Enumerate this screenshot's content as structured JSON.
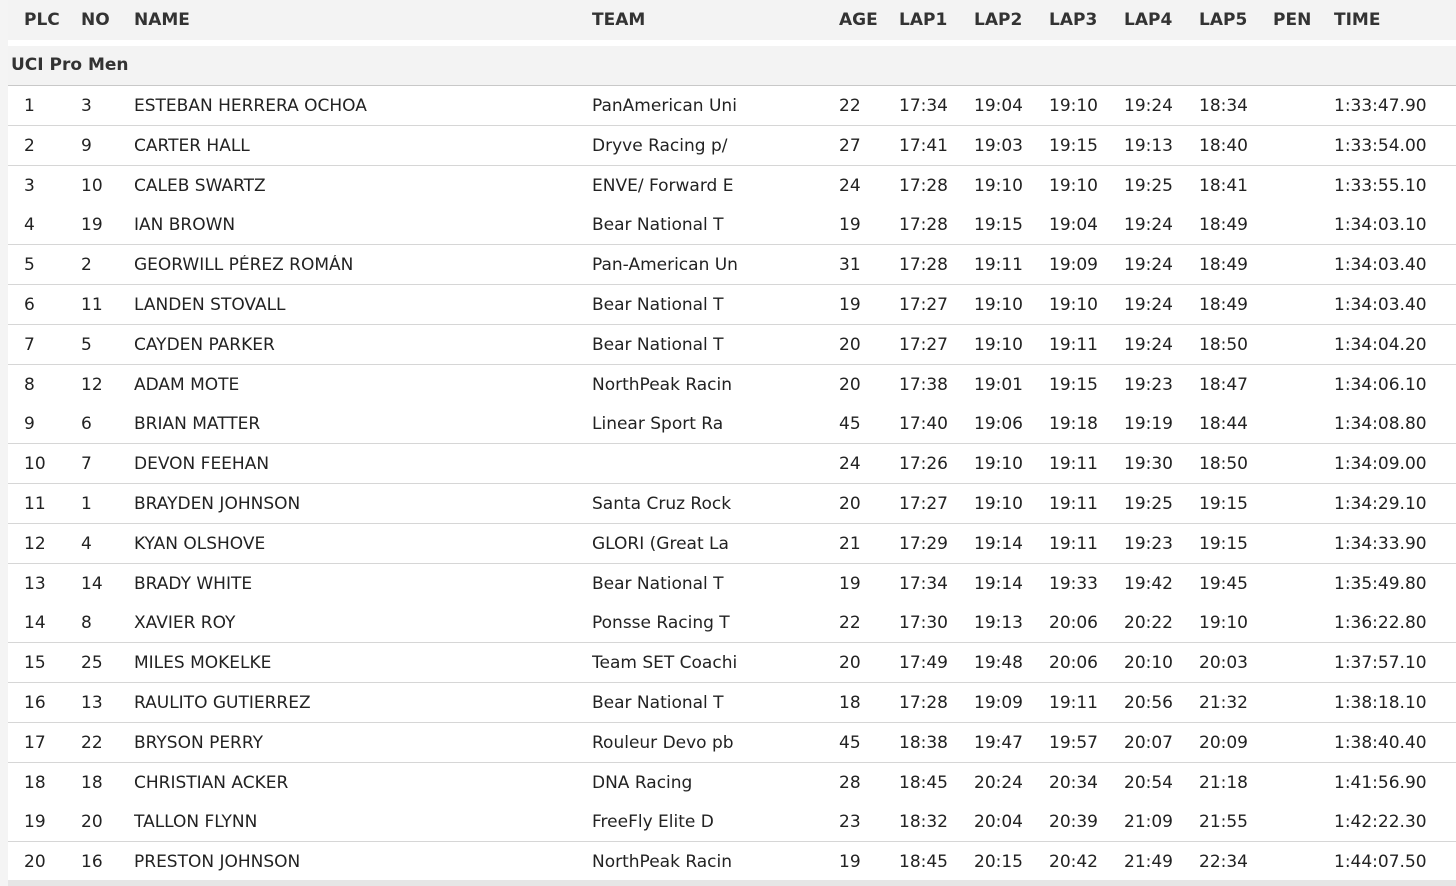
{
  "table": {
    "headers": {
      "plc": "PLC",
      "no": "NO",
      "name": "NAME",
      "team": "TEAM",
      "age": "AGE",
      "lap1": "LAP1",
      "lap2": "LAP2",
      "lap3": "LAP3",
      "lap4": "LAP4",
      "lap5": "LAP5",
      "pen": "PEN",
      "time": "TIME"
    },
    "group": "UCI Pro Men",
    "rows": [
      {
        "plc": "1",
        "no": "3",
        "name": "ESTEBAN HERRERA OCHOA",
        "team": "PanAmerican Uni",
        "age": "22",
        "lap1": "17:34",
        "lap2": "19:04",
        "lap3": "19:10",
        "lap4": "19:24",
        "lap5": "18:34",
        "pen": "",
        "time": "1:33:47.90"
      },
      {
        "plc": "2",
        "no": "9",
        "name": "CARTER HALL",
        "team": "Dryve Racing p/",
        "age": "27",
        "lap1": "17:41",
        "lap2": "19:03",
        "lap3": "19:15",
        "lap4": "19:13",
        "lap5": "18:40",
        "pen": "",
        "time": "1:33:54.00"
      },
      {
        "plc": "3",
        "no": "10",
        "name": "CALEB SWARTZ",
        "team": "ENVE/ Forward E",
        "age": "24",
        "lap1": "17:28",
        "lap2": "19:10",
        "lap3": "19:10",
        "lap4": "19:25",
        "lap5": "18:41",
        "pen": "",
        "time": "1:33:55.10"
      },
      {
        "plc": "4",
        "no": "19",
        "name": "IAN BROWN",
        "team": "Bear National T",
        "age": "19",
        "lap1": "17:28",
        "lap2": "19:15",
        "lap3": "19:04",
        "lap4": "19:24",
        "lap5": "18:49",
        "pen": "",
        "time": "1:34:03.10"
      },
      {
        "plc": "5",
        "no": "2",
        "name": "GEORWILL PÉREZ ROMÁN",
        "team": "Pan-American Un",
        "age": "31",
        "lap1": "17:28",
        "lap2": "19:11",
        "lap3": "19:09",
        "lap4": "19:24",
        "lap5": "18:49",
        "pen": "",
        "time": "1:34:03.40"
      },
      {
        "plc": "6",
        "no": "11",
        "name": "LANDEN STOVALL",
        "team": "Bear National T",
        "age": "19",
        "lap1": "17:27",
        "lap2": "19:10",
        "lap3": "19:10",
        "lap4": "19:24",
        "lap5": "18:49",
        "pen": "",
        "time": "1:34:03.40"
      },
      {
        "plc": "7",
        "no": "5",
        "name": "CAYDEN PARKER",
        "team": "Bear National T",
        "age": "20",
        "lap1": "17:27",
        "lap2": "19:10",
        "lap3": "19:11",
        "lap4": "19:24",
        "lap5": "18:50",
        "pen": "",
        "time": "1:34:04.20"
      },
      {
        "plc": "8",
        "no": "12",
        "name": "ADAM MOTE",
        "team": "NorthPeak Racin",
        "age": "20",
        "lap1": "17:38",
        "lap2": "19:01",
        "lap3": "19:15",
        "lap4": "19:23",
        "lap5": "18:47",
        "pen": "",
        "time": "1:34:06.10"
      },
      {
        "plc": "9",
        "no": "6",
        "name": "BRIAN MATTER",
        "team": "Linear Sport Ra",
        "age": "45",
        "lap1": "17:40",
        "lap2": "19:06",
        "lap3": "19:18",
        "lap4": "19:19",
        "lap5": "18:44",
        "pen": "",
        "time": "1:34:08.80"
      },
      {
        "plc": "10",
        "no": "7",
        "name": "DEVON FEEHAN",
        "team": "",
        "age": "24",
        "lap1": "17:26",
        "lap2": "19:10",
        "lap3": "19:11",
        "lap4": "19:30",
        "lap5": "18:50",
        "pen": "",
        "time": "1:34:09.00"
      },
      {
        "plc": "11",
        "no": "1",
        "name": "BRAYDEN JOHNSON",
        "team": "Santa Cruz Rock",
        "age": "20",
        "lap1": "17:27",
        "lap2": "19:10",
        "lap3": "19:11",
        "lap4": "19:25",
        "lap5": "19:15",
        "pen": "",
        "time": "1:34:29.10"
      },
      {
        "plc": "12",
        "no": "4",
        "name": "KYAN OLSHOVE",
        "team": "GLORI (Great La",
        "age": "21",
        "lap1": "17:29",
        "lap2": "19:14",
        "lap3": "19:11",
        "lap4": "19:23",
        "lap5": "19:15",
        "pen": "",
        "time": "1:34:33.90"
      },
      {
        "plc": "13",
        "no": "14",
        "name": "BRADY WHITE",
        "team": "Bear National T",
        "age": "19",
        "lap1": "17:34",
        "lap2": "19:14",
        "lap3": "19:33",
        "lap4": "19:42",
        "lap5": "19:45",
        "pen": "",
        "time": "1:35:49.80"
      },
      {
        "plc": "14",
        "no": "8",
        "name": "XAVIER ROY",
        "team": "Ponsse Racing T",
        "age": "22",
        "lap1": "17:30",
        "lap2": "19:13",
        "lap3": "20:06",
        "lap4": "20:22",
        "lap5": "19:10",
        "pen": "",
        "time": "1:36:22.80"
      },
      {
        "plc": "15",
        "no": "25",
        "name": "MILES MOKELKE",
        "team": "Team SET Coachi",
        "age": "20",
        "lap1": "17:49",
        "lap2": "19:48",
        "lap3": "20:06",
        "lap4": "20:10",
        "lap5": "20:03",
        "pen": "",
        "time": "1:37:57.10"
      },
      {
        "plc": "16",
        "no": "13",
        "name": "RAULITO GUTIERREZ",
        "team": "Bear National T",
        "age": "18",
        "lap1": "17:28",
        "lap2": "19:09",
        "lap3": "19:11",
        "lap4": "20:56",
        "lap5": "21:32",
        "pen": "",
        "time": "1:38:18.10"
      },
      {
        "plc": "17",
        "no": "22",
        "name": "BRYSON PERRY",
        "team": "Rouleur Devo pb",
        "age": "45",
        "lap1": "18:38",
        "lap2": "19:47",
        "lap3": "19:57",
        "lap4": "20:07",
        "lap5": "20:09",
        "pen": "",
        "time": "1:38:40.40"
      },
      {
        "plc": "18",
        "no": "18",
        "name": "CHRISTIAN ACKER",
        "team": "DNA Racing",
        "age": "28",
        "lap1": "18:45",
        "lap2": "20:24",
        "lap3": "20:34",
        "lap4": "20:54",
        "lap5": "21:18",
        "pen": "",
        "time": "1:41:56.90"
      },
      {
        "plc": "19",
        "no": "20",
        "name": "TALLON FLYNN",
        "team": "FreeFly Elite D",
        "age": "23",
        "lap1": "18:32",
        "lap2": "20:04",
        "lap3": "20:39",
        "lap4": "21:09",
        "lap5": "21:55",
        "pen": "",
        "time": "1:42:22.30"
      },
      {
        "plc": "20",
        "no": "16",
        "name": "PRESTON JOHNSON",
        "team": "NorthPeak Racin",
        "age": "19",
        "lap1": "18:45",
        "lap2": "20:15",
        "lap3": "20:42",
        "lap4": "21:49",
        "lap5": "22:34",
        "pen": "",
        "time": "1:44:07.50"
      }
    ]
  }
}
